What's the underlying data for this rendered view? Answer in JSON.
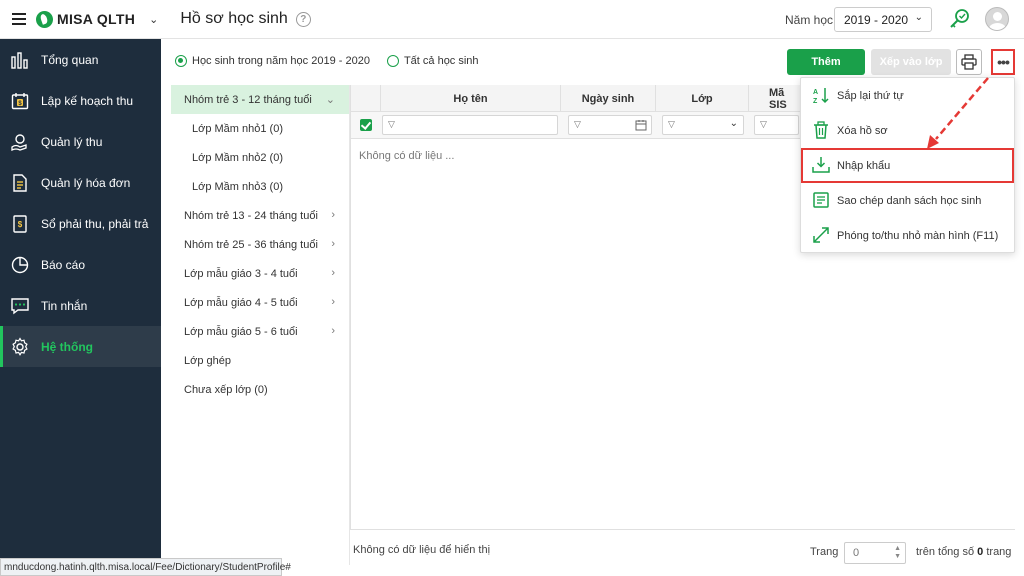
{
  "app": {
    "brand": "MISA QLTH",
    "page_title": "Hồ sơ học sinh",
    "help": "?"
  },
  "topbar": {
    "year_label": "Năm học",
    "year_value": "2019 - 2020"
  },
  "sidebar": {
    "items": [
      {
        "label": "Tổng quan",
        "icon": "dashboard-icon"
      },
      {
        "label": "Lập kế hoạch thu",
        "icon": "calendar-dollar-icon"
      },
      {
        "label": "Quản lý thu",
        "icon": "hand-coin-icon"
      },
      {
        "label": "Quản lý hóa đơn",
        "icon": "invoice-icon"
      },
      {
        "label": "Sổ phải thu, phải trả",
        "icon": "ledger-icon"
      },
      {
        "label": "Báo cáo",
        "icon": "pie-chart-icon"
      },
      {
        "label": "Tin nhắn",
        "icon": "message-icon"
      },
      {
        "label": "Hệ thống",
        "icon": "gear-icon",
        "active": true
      }
    ]
  },
  "filters": {
    "radio_current": "Học sinh trong năm học 2019 - 2020",
    "radio_all": "Tất cả học sinh"
  },
  "toolbar": {
    "add_label": "Thêm",
    "arrange_label": "Xếp vào lớp",
    "more_label": "•••"
  },
  "tree": {
    "items": [
      {
        "label": "Nhóm trẻ 3 - 12 tháng tuổi",
        "type": "group",
        "selected": true,
        "expanded": true
      },
      {
        "label": "Lớp Mầm nhỏ1 (0)",
        "type": "child"
      },
      {
        "label": "Lớp Mầm nhỏ2 (0)",
        "type": "child"
      },
      {
        "label": "Lớp Mầm nhỏ3 (0)",
        "type": "child"
      },
      {
        "label": "Nhóm trẻ 13 - 24 tháng tuổi",
        "type": "group",
        "arrow": true
      },
      {
        "label": "Nhóm trẻ 25 - 36 tháng tuổi",
        "type": "group",
        "arrow": true
      },
      {
        "label": "Lớp mẫu giáo 3 - 4 tuổi",
        "type": "group",
        "arrow": true
      },
      {
        "label": "Lớp mẫu giáo 4 - 5 tuổi",
        "type": "group",
        "arrow": true
      },
      {
        "label": "Lớp mẫu giáo 5 - 6 tuổi",
        "type": "group",
        "arrow": true
      },
      {
        "label": "Lớp ghép",
        "type": "group"
      },
      {
        "label": "Chưa xếp lớp (0)",
        "type": "group"
      }
    ]
  },
  "grid": {
    "columns": [
      "Họ tên",
      "Ngày sinh",
      "Lớp",
      "Mã SIS"
    ],
    "empty_text": "Không có dữ liệu ..."
  },
  "footer": {
    "empty_text": "Không có dữ liệu để hiển thị",
    "page_label": "Trang",
    "page_value": "0",
    "total_prefix": "trên tổng số",
    "total_value": "0",
    "total_suffix": "trang"
  },
  "menu": {
    "items": [
      {
        "label": "Sắp lại thứ tự",
        "icon": "sort-az-icon"
      },
      {
        "label": "Xóa hồ sơ",
        "icon": "trash-icon"
      },
      {
        "label": "Nhập khẩu",
        "icon": "import-icon",
        "highlighted": true
      },
      {
        "label": "Sao chép danh sách học sinh",
        "icon": "copy-list-icon"
      },
      {
        "label": "Phóng to/thu nhỏ màn hình (F11)",
        "icon": "expand-icon"
      }
    ]
  },
  "statusbar": {
    "url": "mnducdong.hatinh.qlth.misa.local/Fee/Dictionary/StudentProfile#"
  },
  "colors": {
    "brand_green": "#1aa04a",
    "sidebar_bg": "#1e2d3d",
    "highlight_red": "#e53935",
    "selected_row": "#d9f2df"
  }
}
